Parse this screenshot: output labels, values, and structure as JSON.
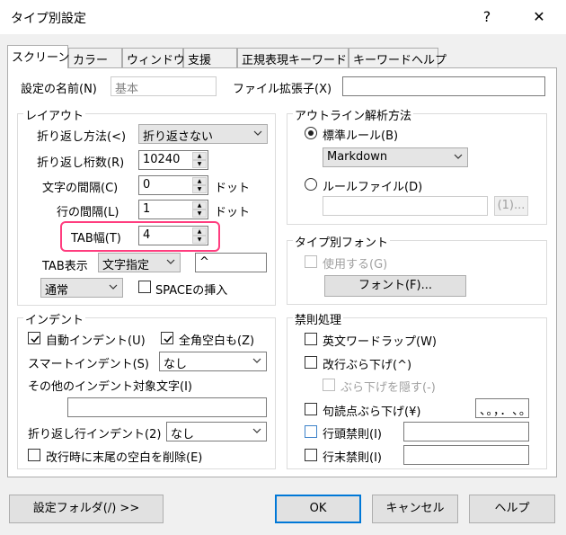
{
  "window": {
    "title": "タイプ別設定",
    "help_label": "?",
    "close_label": "✕"
  },
  "tabs": [
    "スクリーン",
    "カラー",
    "ウィンドウ",
    "支援",
    "正規表現キーワード",
    "キーワードヘルプ"
  ],
  "settings": {
    "name_label": "設定の名前(N)",
    "name_value": "基本",
    "ext_label": "ファイル拡張子(X)",
    "ext_value": ""
  },
  "layout": {
    "title": "レイアウト",
    "wrap_method_label": "折り返し方法(<)",
    "wrap_method_value": "折り返さない",
    "wrap_cols_label": "折り返し桁数(R)",
    "wrap_cols_value": "10240",
    "char_spacing_label": "文字の間隔(C)",
    "char_spacing_value": "0",
    "char_spacing_unit": "ドット",
    "line_spacing_label": "行の間隔(L)",
    "line_spacing_value": "1",
    "line_spacing_unit": "ドット",
    "tab_width_label": "TAB幅(T)",
    "tab_width_value": "4",
    "tab_display_label": "TAB表示",
    "tab_display_value": "文字指定",
    "tab_char_value": "^",
    "tab_style_value": "通常",
    "insert_space_label": "SPACEの挿入"
  },
  "outline": {
    "title": "アウトライン解析方法",
    "standard_rule_label": "標準ルール(B)",
    "rule_value": "Markdown",
    "rule_file_label": "ルールファイル(D)",
    "rule_file_value": "",
    "browse_label": "(1)..."
  },
  "type_font": {
    "title": "タイプ別フォント",
    "use_label": "使用する(G)",
    "font_button_label": "フォント(F)..."
  },
  "indent": {
    "title": "インデント",
    "auto_indent_label": "自動インデント(U)",
    "fullwidth_space_label": "全角空白も(Z)",
    "smart_indent_label": "スマートインデント(S)",
    "smart_indent_value": "なし",
    "other_chars_label": "その他のインデント対象文字(I)",
    "other_chars_value": "",
    "wrap_indent_label": "折り返し行インデント(2)",
    "wrap_indent_value": "なし",
    "remove_trailing_label": "改行時に末尾の空白を削除(E)"
  },
  "kinsoku": {
    "title": "禁則処理",
    "english_wrap_label": "英文ワードラップ(W)",
    "newline_hang_label": "改行ぶら下げ(^)",
    "hide_hang_label": "ぶら下げを隠す(-)",
    "punct_hang_label": "句読点ぶら下げ(¥)",
    "punct_hang_value": "、。，．､｡",
    "line_head_label": "行頭禁則(I)",
    "line_head_value": "",
    "line_end_label": "行末禁則(I)",
    "line_end_value": ""
  },
  "footer": {
    "settings_folder_label": "設定フォルダ(/) >>",
    "ok_label": "OK",
    "cancel_label": "キャンセル",
    "help_label": "ヘルプ"
  }
}
